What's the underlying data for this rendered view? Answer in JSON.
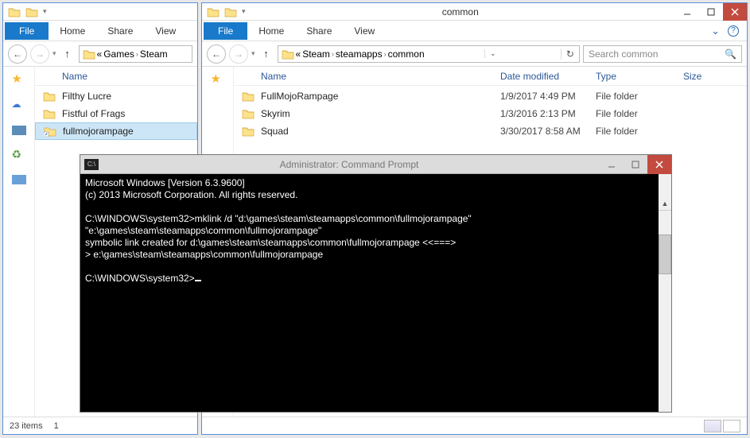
{
  "window_left": {
    "ribbon": {
      "file": "File",
      "tabs": [
        "Home",
        "Share",
        "View"
      ]
    },
    "breadcrumb": {
      "prefix": "«",
      "parts": [
        "Games",
        "Steam"
      ]
    },
    "columns": {
      "name": "Name"
    },
    "files": [
      {
        "name": "Filthy Lucre",
        "selected": false,
        "type": "folder"
      },
      {
        "name": "Fistful of Frags",
        "selected": false,
        "type": "folder"
      },
      {
        "name": "fullmojorampage",
        "selected": true,
        "type": "shortcut"
      }
    ],
    "status": {
      "count": "23 items",
      "selected": "1"
    }
  },
  "window_right": {
    "title": "common",
    "ribbon": {
      "file": "File",
      "tabs": [
        "Home",
        "Share",
        "View"
      ]
    },
    "breadcrumb": {
      "prefix": "«",
      "parts": [
        "Steam",
        "steamapps",
        "common"
      ]
    },
    "search_placeholder": "Search common",
    "columns": {
      "name": "Name",
      "date": "Date modified",
      "type": "Type",
      "size": "Size"
    },
    "files": [
      {
        "name": "FullMojoRampage",
        "date": "1/9/2017 4:49 PM",
        "type": "File folder"
      },
      {
        "name": "Skyrim",
        "date": "1/3/2016 2:13 PM",
        "type": "File folder"
      },
      {
        "name": "Squad",
        "date": "3/30/2017 8:58 AM",
        "type": "File folder"
      }
    ]
  },
  "cmd": {
    "title": "Administrator: Command Prompt",
    "lines": [
      "Microsoft Windows [Version 6.3.9600]",
      "(c) 2013 Microsoft Corporation. All rights reserved.",
      "",
      "C:\\WINDOWS\\system32>mklink /d \"d:\\games\\steam\\steamapps\\common\\fullmojorampage\"",
      "\"e:\\games\\steam\\steamapps\\common\\fullmojorampage\"",
      "symbolic link created for d:\\games\\steam\\steamapps\\common\\fullmojorampage <<===>",
      "> e:\\games\\steam\\steamapps\\common\\fullmojorampage",
      "",
      "C:\\WINDOWS\\system32>"
    ]
  }
}
